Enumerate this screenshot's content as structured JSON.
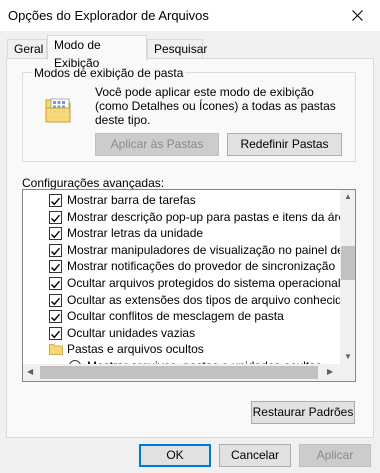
{
  "window": {
    "title": "Opções do Explorador de Arquivos"
  },
  "tabs": [
    {
      "label": "Geral"
    },
    {
      "label": "Modo de Exibição"
    },
    {
      "label": "Pesquisar"
    }
  ],
  "folder_views": {
    "legend": "Modos de exibição de pasta",
    "description": "Você pode aplicar este modo de exibição (como Detalhes ou Ícones) a todas as pastas deste tipo.",
    "apply_label": "Aplicar às Pastas",
    "reset_label": "Redefinir Pastas"
  },
  "advanced": {
    "label": "Configurações avançadas:",
    "items": [
      {
        "type": "checkbox",
        "checked": true,
        "label": "Mostrar barra de tarefas"
      },
      {
        "type": "checkbox",
        "checked": true,
        "label": "Mostrar descrição pop-up para pastas e itens da área de t"
      },
      {
        "type": "checkbox",
        "checked": true,
        "label": "Mostrar letras da unidade"
      },
      {
        "type": "checkbox",
        "checked": true,
        "label": "Mostrar manipuladores de visualização no painel de visua"
      },
      {
        "type": "checkbox",
        "checked": true,
        "label": "Mostrar notificações do provedor de sincronização"
      },
      {
        "type": "checkbox",
        "checked": true,
        "label": "Ocultar arquivos protegidos do sistema operacional (Reco"
      },
      {
        "type": "checkbox",
        "checked": true,
        "label": "Ocultar as extensões dos tipos de arquivo conhecidos"
      },
      {
        "type": "checkbox",
        "checked": true,
        "label": "Ocultar conflitos de mesclagem de pasta"
      },
      {
        "type": "checkbox",
        "checked": true,
        "label": "Ocultar unidades vazias"
      },
      {
        "type": "folder",
        "label": "Pastas e arquivos ocultos"
      },
      {
        "type": "radio",
        "checked": false,
        "label": "Mostrar arquivos, pastas e unidades ocultas"
      }
    ],
    "restore_label": "Restaurar Padrões"
  },
  "buttons": {
    "ok": "OK",
    "cancel": "Cancelar",
    "apply": "Aplicar"
  },
  "colors": {
    "accent": "#0078d7",
    "checkmark": "#000000",
    "folder": "#f8d775"
  }
}
